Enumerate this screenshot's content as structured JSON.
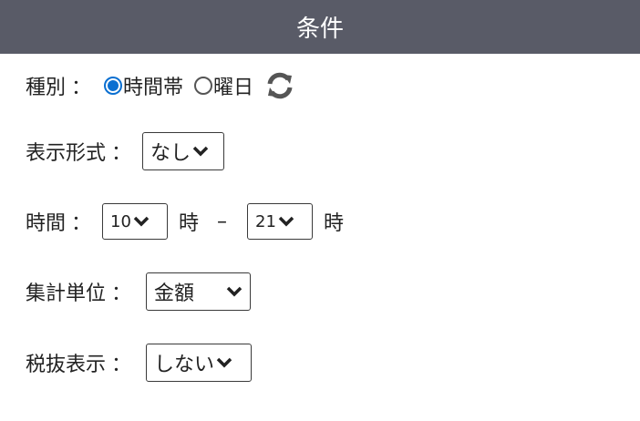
{
  "header": {
    "title": "条件"
  },
  "type_row": {
    "label": "種別",
    "colon": "：",
    "options": [
      {
        "label": "時間帯",
        "checked": true
      },
      {
        "label": "曜日",
        "checked": false
      }
    ],
    "refresh_icon": "refresh-icon"
  },
  "display_format": {
    "label": "表示形式",
    "colon": "：",
    "value": "なし"
  },
  "time": {
    "label": "時間",
    "colon": "：",
    "start": "10",
    "start_unit": "時",
    "separator": "–",
    "end": "21",
    "end_unit": "時"
  },
  "aggregation": {
    "label": "集計単位",
    "colon": "：",
    "value": "金額"
  },
  "tax": {
    "label": "税抜表示",
    "colon": "：",
    "value": "しない"
  },
  "colors": {
    "header_bg": "#595b67",
    "radio_accent": "#0a6fd1",
    "icon": "#555555"
  }
}
